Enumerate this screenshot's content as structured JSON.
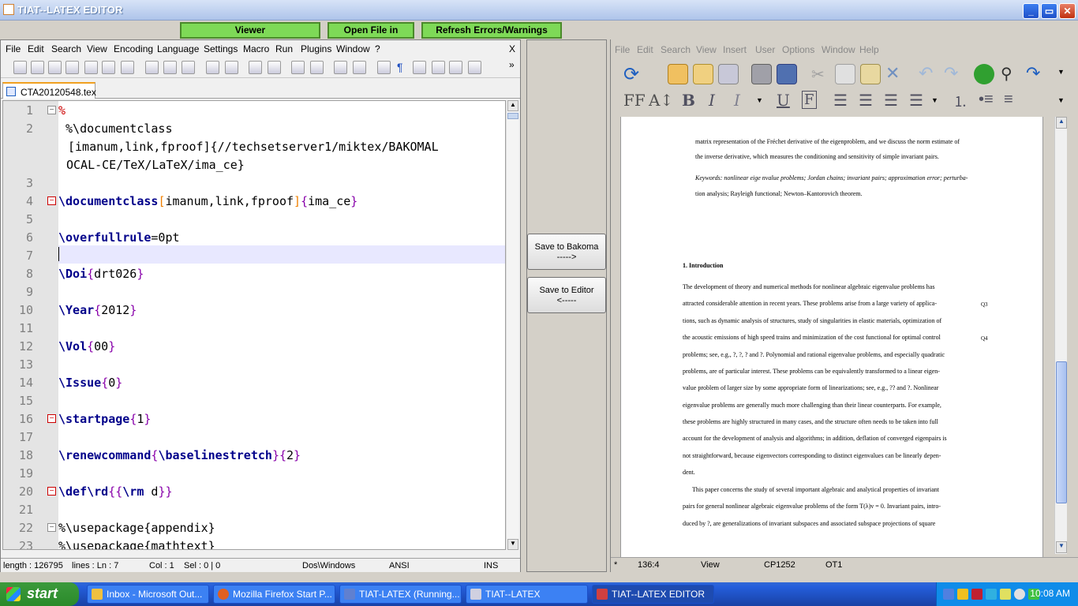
{
  "window": {
    "title": "TIAT--LATEX EDITOR"
  },
  "topbar": {
    "viewer": "Viewer",
    "open_file": "Open File in",
    "refresh": "Refresh Errors/Warnings"
  },
  "editor": {
    "menu": [
      "File",
      "Edit",
      "Search",
      "View",
      "Encoding",
      "Language",
      "Settings",
      "Macro",
      "Run",
      "Plugins",
      "Window",
      "?"
    ],
    "menu_close": "X",
    "tab_name": "CTA20120548.tex",
    "lines": {
      "l1": "%",
      "l2a": " %\\documentclass",
      "l2b": "[imanum,link,fproof]{//techsetserver1/miktex/BAKOMAL",
      "l2c": "OCAL-CE/TeX/LaTeX/ima_ce}",
      "l4_cmd": "\\documentclass",
      "l4_opt": "imanum,link,fproof",
      "l4_arg": "ima_ce",
      "l6_cmd": "\\overfullrule",
      "l6_val": "=0pt",
      "l8_cmd": "\\Doi",
      "l8_arg": "drt026",
      "l10_cmd": "\\Year",
      "l10_arg": "2012",
      "l12_cmd": "\\Vol",
      "l12_arg": "00",
      "l14_cmd": "\\Issue",
      "l14_arg": "0",
      "l16_cmd": "\\startpage",
      "l16_arg": "1",
      "l18_cmd1": "\\renewcommand",
      "l18_cmd2": "\\baselinestretch",
      "l18_arg": "2",
      "l20_cmd1": "\\def",
      "l20_cmd2": "\\rd",
      "l20_rm": "\\rm",
      "l20_d": " d",
      "l22": "%\\usepackage{appendix}",
      "l23": "%\\usepackage{mathtext}"
    },
    "line_numbers": [
      "1",
      "2",
      "",
      "",
      "3",
      "4",
      "5",
      "6",
      "7",
      "8",
      "9",
      "10",
      "11",
      "12",
      "13",
      "14",
      "15",
      "16",
      "17",
      "18",
      "19",
      "20",
      "21",
      "22",
      "23"
    ],
    "status": {
      "length": "length : 126795",
      "lines": "lines : Ln : 7",
      "col": "Col : 1",
      "sel": "Sel : 0 | 0",
      "eol": "Dos\\Windows",
      "enc": "ANSI",
      "mode": "INS"
    }
  },
  "middle": {
    "save_bakoma": "Save to Bakoma",
    "arrow_right": "----->",
    "save_editor": "Save to Editor",
    "arrow_left": "<-----"
  },
  "viewer": {
    "menu": [
      "File",
      "Edit",
      "Search",
      "View",
      "Insert",
      "User",
      "Options",
      "Window",
      "Help"
    ],
    "text": {
      "p0a": "matrix representation of the Fréchet derivative of the eigenproblem, and we discuss the norm estimate of",
      "p0b": "the inverse derivative, which measures the conditioning and sensitivity of simple invariant pairs.",
      "kw_a": "Keywords: nonlinear eige nvalue problems; Jordan chains; invariant pairs; approximation error; perturba-",
      "kw_b": "tion analysis; Rayleigh functional; Newton–Kantorovich theorem.",
      "section": "1.  Introduction",
      "b1": "The development of theory and numerical methods for nonlinear algebraic eigenvalue problems has",
      "b2": "attracted considerable attention in recent years. These problems arise from a large variety of applica-",
      "b3": "tions, such as dynamic analysis of structures, study of singularities in elastic materials, optimization of",
      "b4": "the acoustic emissions of high speed trains and minimization of the cost functional for optimal control",
      "b5": "problems; see, e.g., ?, ?, ? and ?. Polynomial and rational eigenvalue problems, and especially quadratic",
      "b6": "problems, are of particular interest. These problems can be equivalently transformed to a linear eigen-",
      "b7": "value problem of larger size by some appropriate form of linearizations; see, e.g., ?? and ?. Nonlinear",
      "b8": "eigenvalue problems are generally much more challenging than their linear counterparts. For example,",
      "b9": "these problems are highly structured in many cases, and the structure often needs to be taken into full",
      "b10": "account for the development of analysis and algorithms; in addition, deflation of converged eigenpairs is",
      "b11": "not straightforward, because eigenvectors corresponding to distinct eigenvalues can be linearly depen-",
      "b12": "dent.",
      "b13": "This paper concerns the study of several important algebraic and analytical properties of invariant",
      "b14": "pairs for general nonlinear algebraic eigenvalue problems of the form T(λ)v = 0. Invariant pairs, intro-",
      "b15": "duced by ?, are generalizations of invariant subspaces and associated subspace projections of square",
      "q1": "Q3",
      "q2": "Q4"
    },
    "status": {
      "mod": "*",
      "pos": "136:4",
      "mode": "View",
      "cp": "CP1252",
      "font": "OT1"
    }
  },
  "taskbar": {
    "start": "start",
    "tasks": [
      "Inbox - Microsoft Out...",
      "Mozilla Firefox Start P...",
      "TIAT-LATEX (Running...",
      "TIAT--LATEX",
      "TIAT--LATEX EDITOR"
    ],
    "time": "10:08 AM"
  }
}
